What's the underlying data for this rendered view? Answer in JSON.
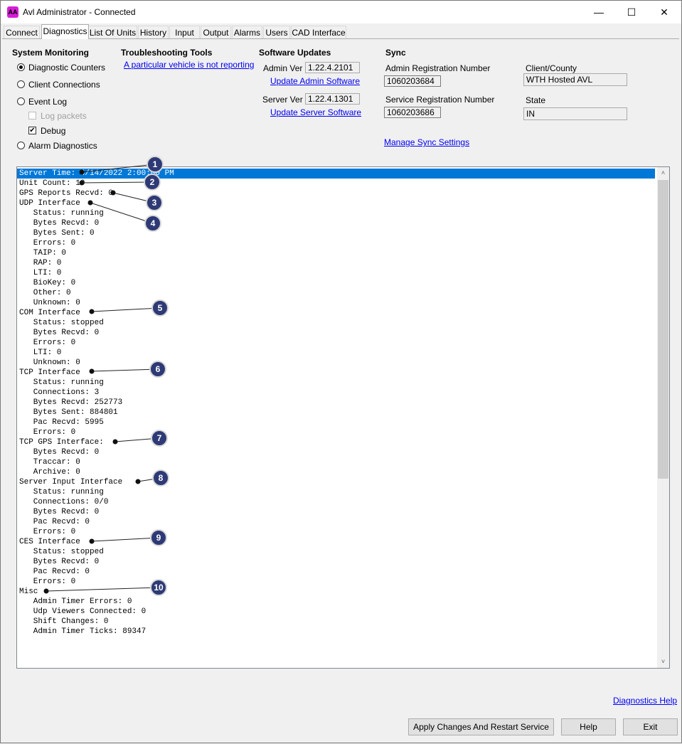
{
  "window": {
    "title": "Avl Administrator - Connected",
    "icon_label": "AA",
    "minimize": "—",
    "maximize": "☐",
    "close": "✕"
  },
  "tabs": [
    "Connect",
    "Diagnostics",
    "List Of Units",
    "History",
    "Input",
    "Output",
    "Alarms",
    "Users",
    "CAD Interface"
  ],
  "active_tab": "Diagnostics",
  "system_monitoring": {
    "title": "System Monitoring",
    "options": [
      "Diagnostic Counters",
      "Client Connections",
      "Event Log",
      "Alarm Diagnostics"
    ],
    "selected": "Diagnostic Counters",
    "log_packets": "Log packets",
    "log_packets_checked": false,
    "debug": "Debug",
    "debug_checked": true,
    "check_mark": "✔"
  },
  "troubleshooting": {
    "title": "Troubleshooting Tools",
    "link": "A particular vehicle is not reporting"
  },
  "software_updates": {
    "title": "Software Updates",
    "admin_ver_label": "Admin Ver",
    "admin_ver": "1.22.4.2101",
    "update_admin": "Update Admin Software",
    "server_ver_label": "Server Ver",
    "server_ver": "1.22.4.1301",
    "update_server": "Update Server Software"
  },
  "sync": {
    "title": "Sync",
    "admin_reg_label": "Admin Registration Number",
    "admin_reg": "1060203684",
    "service_reg_label": "Service Registration Number",
    "service_reg": "1060203686",
    "client_county_label": "Client/County",
    "client_county": "WTH Hosted AVL",
    "state_label": "State",
    "state": "IN",
    "manage_sync": "Manage Sync Settings"
  },
  "diagnostics_output": [
    "Server Time: 4/14/2022 2:00:00 PM",
    "Unit Count: 10",
    "GPS Reports Recvd: 0",
    "UDP Interface",
    "   Status: running",
    "   Bytes Recvd: 0",
    "   Bytes Sent: 0",
    "   Errors: 0",
    "   TAIP: 0",
    "   RAP: 0",
    "   LTI: 0",
    "   BioKey: 0",
    "   Other: 0",
    "   Unknown: 0",
    "COM Interface",
    "   Status: stopped",
    "   Bytes Recvd: 0",
    "   Errors: 0",
    "   LTI: 0",
    "   Unknown: 0",
    "TCP Interface",
    "   Status: running",
    "   Connections: 3",
    "   Bytes Recvd: 252773",
    "   Bytes Sent: 884801",
    "   Pac Recvd: 5995",
    "   Errors: 0",
    "TCP GPS Interface:",
    "   Bytes Recvd: 0",
    "   Traccar: 0",
    "   Archive: 0",
    "Server Input Interface",
    "   Status: running",
    "   Connections: 0/0",
    "   Bytes Recvd: 0",
    "   Pac Recvd: 0",
    "   Errors: 0",
    "CES Interface",
    "   Status: stopped",
    "   Bytes Recvd: 0",
    "   Pac Recvd: 0",
    "   Errors: 0",
    "Misc",
    "   Admin Timer Errors: 0",
    "   Udp Viewers Connected: 0",
    "   Shift Changes: 0",
    "   Admin Timer Ticks: 89347"
  ],
  "selected_line": 0,
  "scroll": {
    "up": "˄",
    "down": "˅"
  },
  "callouts": [
    "1",
    "2",
    "3",
    "4",
    "5",
    "6",
    "7",
    "8",
    "9",
    "10"
  ],
  "diagnostics_help": "Diagnostics Help",
  "buttons": {
    "apply": "Apply Changes And Restart Service",
    "help": "Help",
    "exit": "Exit"
  }
}
